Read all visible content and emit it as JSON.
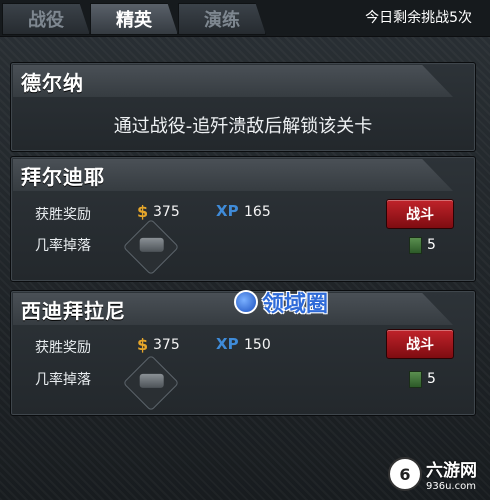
{
  "tabs": [
    {
      "label": "战役",
      "active": false
    },
    {
      "label": "精英",
      "active": true
    },
    {
      "label": "演练",
      "active": false
    }
  ],
  "remaining_text": "今日剩余挑战5次",
  "locked_stage": {
    "title": "德尔纳",
    "message": "通过战役-追歼溃敌后解锁该关卡"
  },
  "stages": [
    {
      "title": "拜尔迪耶",
      "reward_label": "获胜奖励",
      "coin_icon": "dollar-icon",
      "coins": "375",
      "xp_label": "XP",
      "xp": "165",
      "battle_label": "战斗",
      "drop_label": "几率掉落",
      "drop_icon": "tank-icon",
      "card_count": "5"
    },
    {
      "title": "西迪拜拉尼",
      "reward_label": "获胜奖励",
      "coin_icon": "dollar-icon",
      "coins": "375",
      "xp_label": "XP",
      "xp": "150",
      "battle_label": "战斗",
      "drop_label": "几率掉落",
      "drop_icon": "tank-icon",
      "card_count": "5"
    }
  ],
  "watermark": "领域圈",
  "site_logo": {
    "name": "六游网",
    "url": "936u.com"
  },
  "colors": {
    "battle_button": "#b01c22",
    "coin": "#e6a62a",
    "xp": "#3f8bd8"
  }
}
